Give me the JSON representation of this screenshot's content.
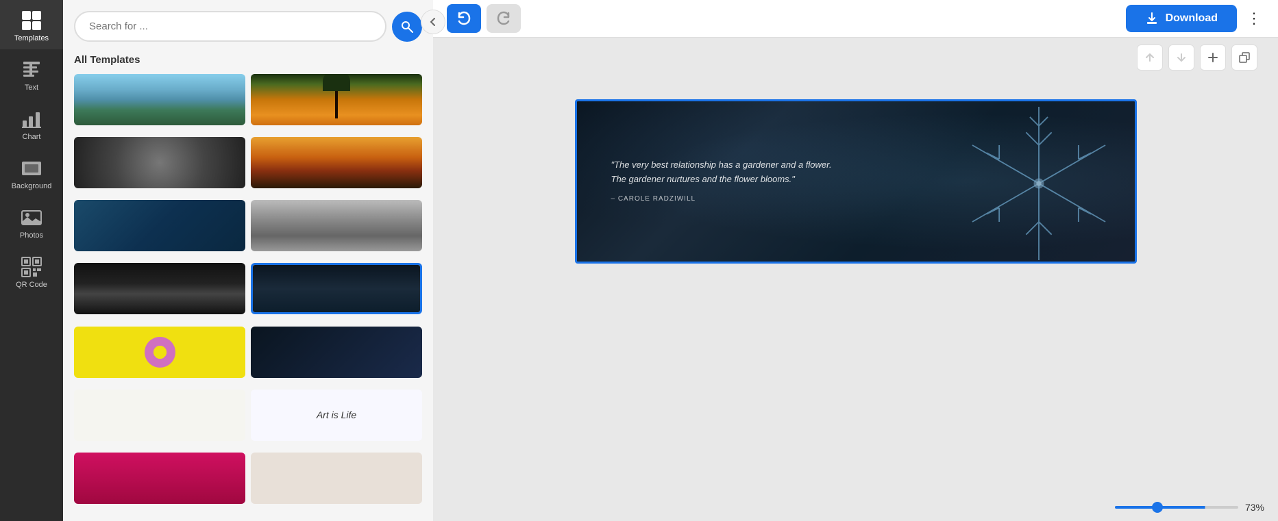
{
  "sidebar": {
    "items": [
      {
        "id": "templates",
        "label": "Templates",
        "icon": "grid"
      },
      {
        "id": "text",
        "label": "Text",
        "icon": "text"
      },
      {
        "id": "chart",
        "label": "Chart",
        "icon": "chart"
      },
      {
        "id": "background",
        "label": "Background",
        "icon": "background"
      },
      {
        "id": "photos",
        "label": "Photos",
        "icon": "photos"
      },
      {
        "id": "qrcode",
        "label": "QR Code",
        "icon": "qr"
      }
    ]
  },
  "search": {
    "placeholder": "Search for ..."
  },
  "panel": {
    "section_title": "All Templates"
  },
  "toolbar": {
    "download_label": "Download",
    "undo_label": "↺",
    "redo_label": "↻"
  },
  "canvas": {
    "quote_text": "\"The very best relationship has a gardener and a flower. The gardener nurtures and the flower blooms.\"",
    "quote_author": "– CAROLE RADZIWILL"
  },
  "zoom": {
    "value": 73,
    "label": "73%"
  }
}
